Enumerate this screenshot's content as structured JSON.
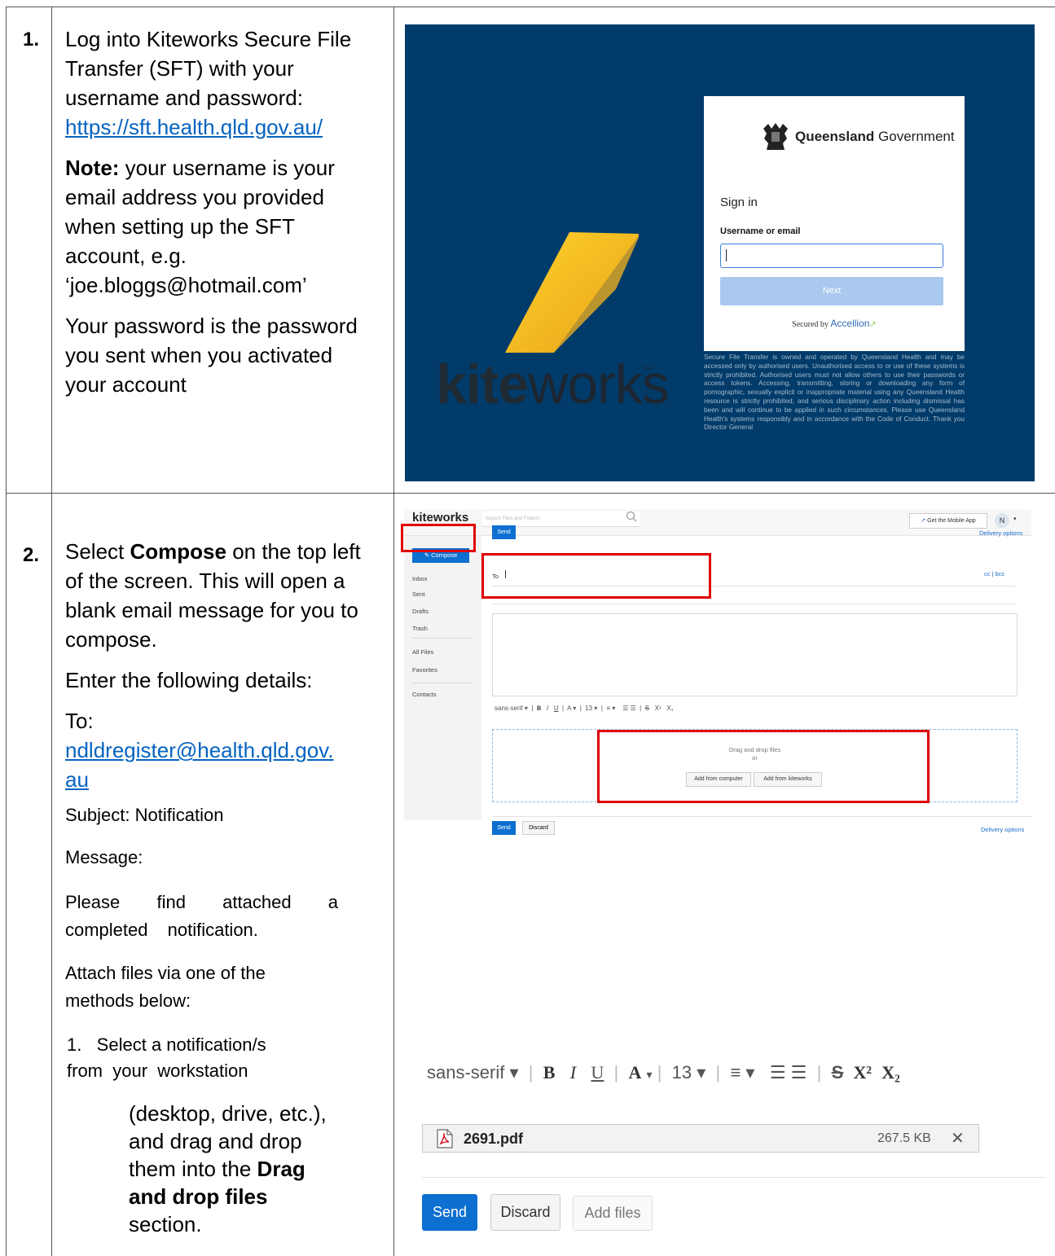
{
  "step1": {
    "number": "1.",
    "intro": "Log into Kiteworks Secure File Transfer (SFT) with your username and password:",
    "url": "https://sft.health.qld.gov.au/",
    "note_label": "Note:",
    "note_text": " your username is your email address you provided when setting up the SFT account, e.g. ‘joe.bloggs@hotmail.com’",
    "password_text": "Your password is the password you sent when you activated your account"
  },
  "login_screen": {
    "logo_bold": "kite",
    "logo_rest": "works",
    "logo_tm": "™",
    "org_bold": "Queensland",
    "org_rest": " Government",
    "signin_title": "Sign in",
    "username_label": "Username or email",
    "username_value": "",
    "next_label": "Next",
    "secured_by": "Secured by ",
    "secured_brand": "Accellion",
    "disclaimer": "Secure File Transfer is owned and operated by Queensland Health and may be accessed only by authorised users. Unauthorised access to or use of these systems is strictly prohibited. Authorised users must not allow others to use their passwords or access tokens. Accessing, transmitting, storing or downloading any form of pornographic, sexually explicit or inappropriate material using any Queensland Health resource is strictly prohibited, and serious disciplinary action including dismissal has been and will continue to be applied in such circumstances. Please use Queensland Health's systems responsibly and in accordance with the Code of Conduct. Thank you Director General",
    "colors": {
      "background": "#003b6a",
      "next_button": "#a9c9ef"
    }
  },
  "step2": {
    "number": "2.",
    "compose_pre": "Select ",
    "compose_bold": "Compose",
    "compose_post": " on the top left of the screen. This will open a blank email message for you to compose.",
    "enter_details": "Enter the following details:",
    "to_label": "To:",
    "to_email_line1": "ndldregister@health.qld.gov.",
    "to_email_line2": "au",
    "subject": "Subject: Notification",
    "message_label": "Message:",
    "message_body": "Please find attached a completed notification.",
    "attach_intro": "Attach files via one of the methods below:",
    "method1_line1": "1.   Select a notification/s",
    "method1_line2": "from  your  workstation",
    "method1_cont1": "(desktop, drive, etc.),",
    "method1_cont2": "and drag and drop",
    "method1_cont3_pre": "them into the ",
    "method1_cont3_bold": "Drag",
    "method1_cont4_bold": "and drop files",
    "method1_cont5": "section."
  },
  "compose_screen": {
    "logo": "kiteworks",
    "search_placeholder": "Search Files and Folders",
    "mobile_app": "Get the Mobile App",
    "avatar": "N",
    "compose_button": "Compose",
    "nav": [
      "Inbox",
      "Sent",
      "Drafts",
      "Trash",
      "All Files",
      "Favorites",
      "Contacts"
    ],
    "to_label": "To",
    "cc_bcc": "cc | bcc",
    "toolbar": {
      "font": "sans-serif ▾",
      "bold": "B",
      "italic": "I",
      "underline": "U",
      "color": "A ▾",
      "size": "13 ▾",
      "align": "≡ ▾",
      "lists": "☰  ☰",
      "strike": "S",
      "sup": "X¹",
      "sub": "X₁"
    },
    "drop_text": "Drag and drop files",
    "drop_or": "or",
    "add_from_computer": "Add from computer",
    "add_from_kiteworks": "Add from kiteworks",
    "send": "Send",
    "discard": "Discard",
    "delivery_options": "Delivery options",
    "colors": {
      "primary": "#0d6fd0",
      "highlight": "#e00000"
    }
  },
  "attach_screen": {
    "toolbar": {
      "font": "sans-serif ▾",
      "bold": "B",
      "italic": "I",
      "underline": "U",
      "color": "A",
      "color_caret": "▾",
      "size": "13 ▾",
      "align": "≡ ▾",
      "lists": "☰   ☰",
      "strike": "S",
      "sup": "X²",
      "sub": "X₂"
    },
    "file_name": "2691.pdf",
    "file_size": "267.5 KB",
    "remove": "✕",
    "send": "Send",
    "discard": "Discard",
    "add_files": "Add files"
  }
}
